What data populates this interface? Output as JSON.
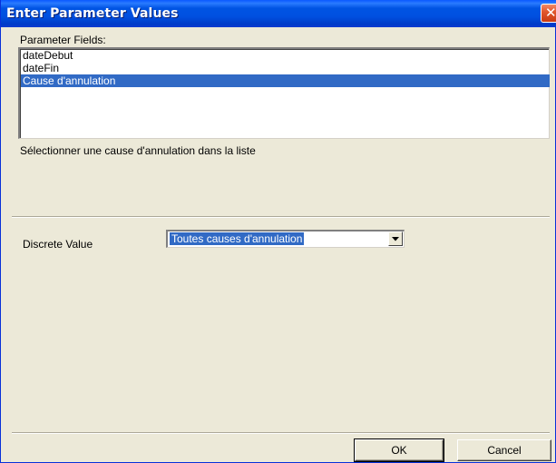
{
  "window": {
    "title": "Enter Parameter Values",
    "close_glyph": "✕"
  },
  "parameters": {
    "label": "Parameter Fields:",
    "items": [
      {
        "label": "dateDebut",
        "selected": false
      },
      {
        "label": "dateFin",
        "selected": false
      },
      {
        "label": "Cause d'annulation",
        "selected": true
      }
    ],
    "description": "Sélectionner une cause d'annulation dans la liste"
  },
  "value": {
    "label": "Discrete Value",
    "selected": "Toutes causes d'annulation"
  },
  "buttons": {
    "ok": "OK",
    "cancel": "Cancel"
  },
  "colors": {
    "titlebar": "#0054e3",
    "selection": "#316ac5",
    "dialog_bg": "#ece9d8",
    "close_button": "#e2582e"
  }
}
